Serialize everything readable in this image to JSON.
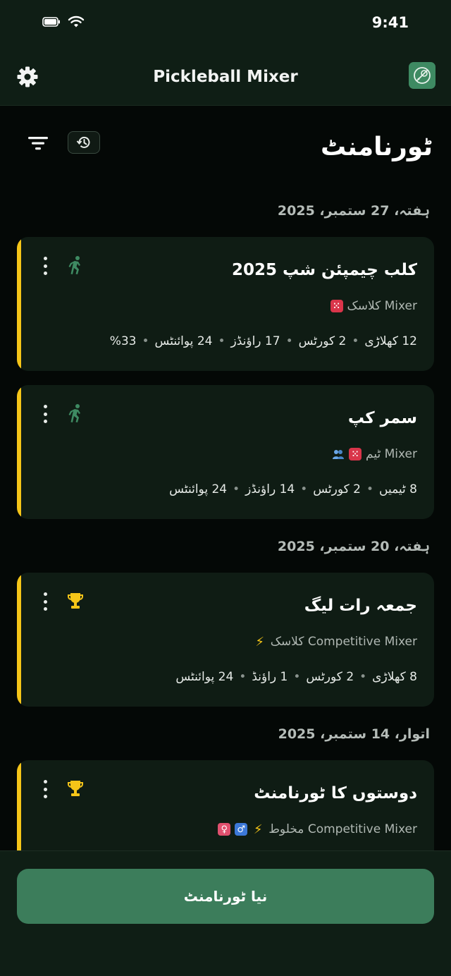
{
  "status_bar": {
    "time": "9:41",
    "icons": [
      "battery-icon",
      "wifi-icon"
    ]
  },
  "app_bar": {
    "title": "Pickleball Mixer",
    "settings_icon": "gear-icon",
    "logo_icon": "pickleball-logo-icon"
  },
  "toolbar": {
    "filter_icon": "filter-icon",
    "history_icon": "history-icon"
  },
  "page": {
    "title": "ٹورنامنٹ"
  },
  "groups": [
    {
      "date": "ہفتہ، 27 ستمبر، 2025",
      "cards": [
        {
          "title": "کلب چیمپئن شپ 2025",
          "subtitle": "Mixer کلاسک",
          "status_icon": "running-icon",
          "badges": [
            "dice-icon"
          ],
          "stats": [
            "12 کھلاڑی",
            "2 کورٹس",
            "17 راؤنڈز",
            "24 پوائنٹس",
            "33%"
          ]
        },
        {
          "title": "سمر کپ",
          "subtitle": "Mixer ٹیم",
          "status_icon": "running-icon",
          "badges": [
            "dice-icon",
            "team-icon"
          ],
          "stats": [
            "8 ٹیمیں",
            "2 کورٹس",
            "14 راؤنڈز",
            "24 پوائنٹس"
          ]
        }
      ]
    },
    {
      "date": "ہفتہ، 20 ستمبر، 2025",
      "cards": [
        {
          "title": "جمعہ رات لیگ",
          "subtitle": "Competitive Mixer کلاسک",
          "status_icon": "trophy-icon",
          "badges": [
            "lightning-icon"
          ],
          "stats": [
            "8 کھلاڑی",
            "2 کورٹس",
            "1 راؤنڈ",
            "24 پوائنٹس"
          ]
        }
      ]
    },
    {
      "date": "اتوار، 14 ستمبر، 2025",
      "cards": [
        {
          "title": "دوستوں کا ٹورنامنٹ",
          "subtitle": "Competitive Mixer مخلوط",
          "status_icon": "trophy-icon",
          "badges": [
            "lightning-icon",
            "male-icon",
            "female-icon"
          ],
          "stats": []
        }
      ]
    }
  ],
  "footer": {
    "new_tournament_label": "نیا ٹورنامنٹ"
  },
  "colors": {
    "accent": "#3c7d5b",
    "card_stripe": "#f5c518",
    "background": "#040806",
    "card": "#0f1c14",
    "trophy": "#f5c518",
    "running": "#3e8a62"
  }
}
